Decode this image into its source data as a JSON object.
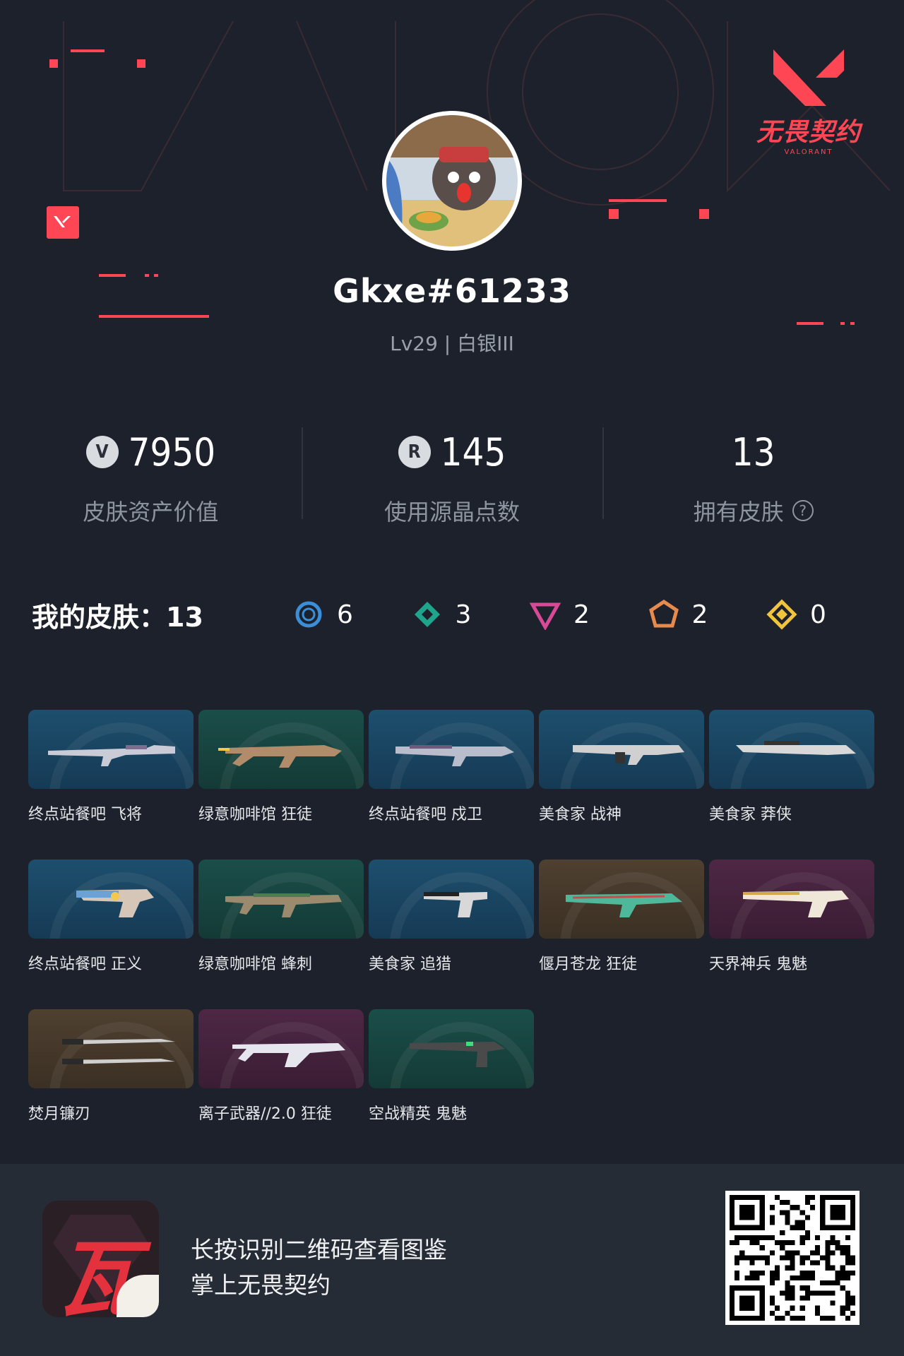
{
  "brand": {
    "logo_cn": "无畏契约",
    "logo_en": "VALORANT",
    "accent": "#ff4655"
  },
  "profile": {
    "username": "Gkxe#61233",
    "level": "Lv29 | 白银III"
  },
  "stats": [
    {
      "icon": "vp-coin-icon",
      "glyph": "V",
      "value": "7950",
      "label": "皮肤资产价值"
    },
    {
      "icon": "radianite-icon",
      "glyph": "R",
      "value": "145",
      "label": "使用源晶点数"
    },
    {
      "icon": "",
      "glyph": "",
      "value": "13",
      "label": "拥有皮肤"
    }
  ],
  "skins": {
    "title": "我的皮肤：13",
    "tiers": [
      {
        "name": "select-tier",
        "color": "#3a8fd8",
        "count": "6"
      },
      {
        "name": "deluxe-tier",
        "color": "#1fa58c",
        "count": "3"
      },
      {
        "name": "premium-tier",
        "color": "#d84a96",
        "count": "2"
      },
      {
        "name": "exclusive-tier",
        "color": "#e88a4c",
        "count": "2"
      },
      {
        "name": "ultra-tier",
        "color": "#f1c43d",
        "count": "0"
      }
    ],
    "items": [
      {
        "label": "终点站餐吧 飞将",
        "bg": "blue"
      },
      {
        "label": "绿意咖啡馆 狂徒",
        "bg": "teal"
      },
      {
        "label": "终点站餐吧 戍卫",
        "bg": "blue"
      },
      {
        "label": "美食家 战神",
        "bg": "blue"
      },
      {
        "label": "美食家 莽侠",
        "bg": "blue"
      },
      {
        "label": "终点站餐吧 正义",
        "bg": "blue"
      },
      {
        "label": "绿意咖啡馆 蜂刺",
        "bg": "teal"
      },
      {
        "label": "美食家 追猎",
        "bg": "blue"
      },
      {
        "label": "偃月苍龙 狂徒",
        "bg": "gold"
      },
      {
        "label": "天界神兵 鬼魅",
        "bg": "purple"
      },
      {
        "label": "焚月镰刃",
        "bg": "gold"
      },
      {
        "label": "离子武器//2.0 狂徒",
        "bg": "purple"
      },
      {
        "label": "空战精英 鬼魅",
        "bg": "teal"
      }
    ]
  },
  "footer": {
    "line1": "长按识别二维码查看图鉴",
    "line2": "掌上无畏契约",
    "app_glyph": "瓦"
  }
}
